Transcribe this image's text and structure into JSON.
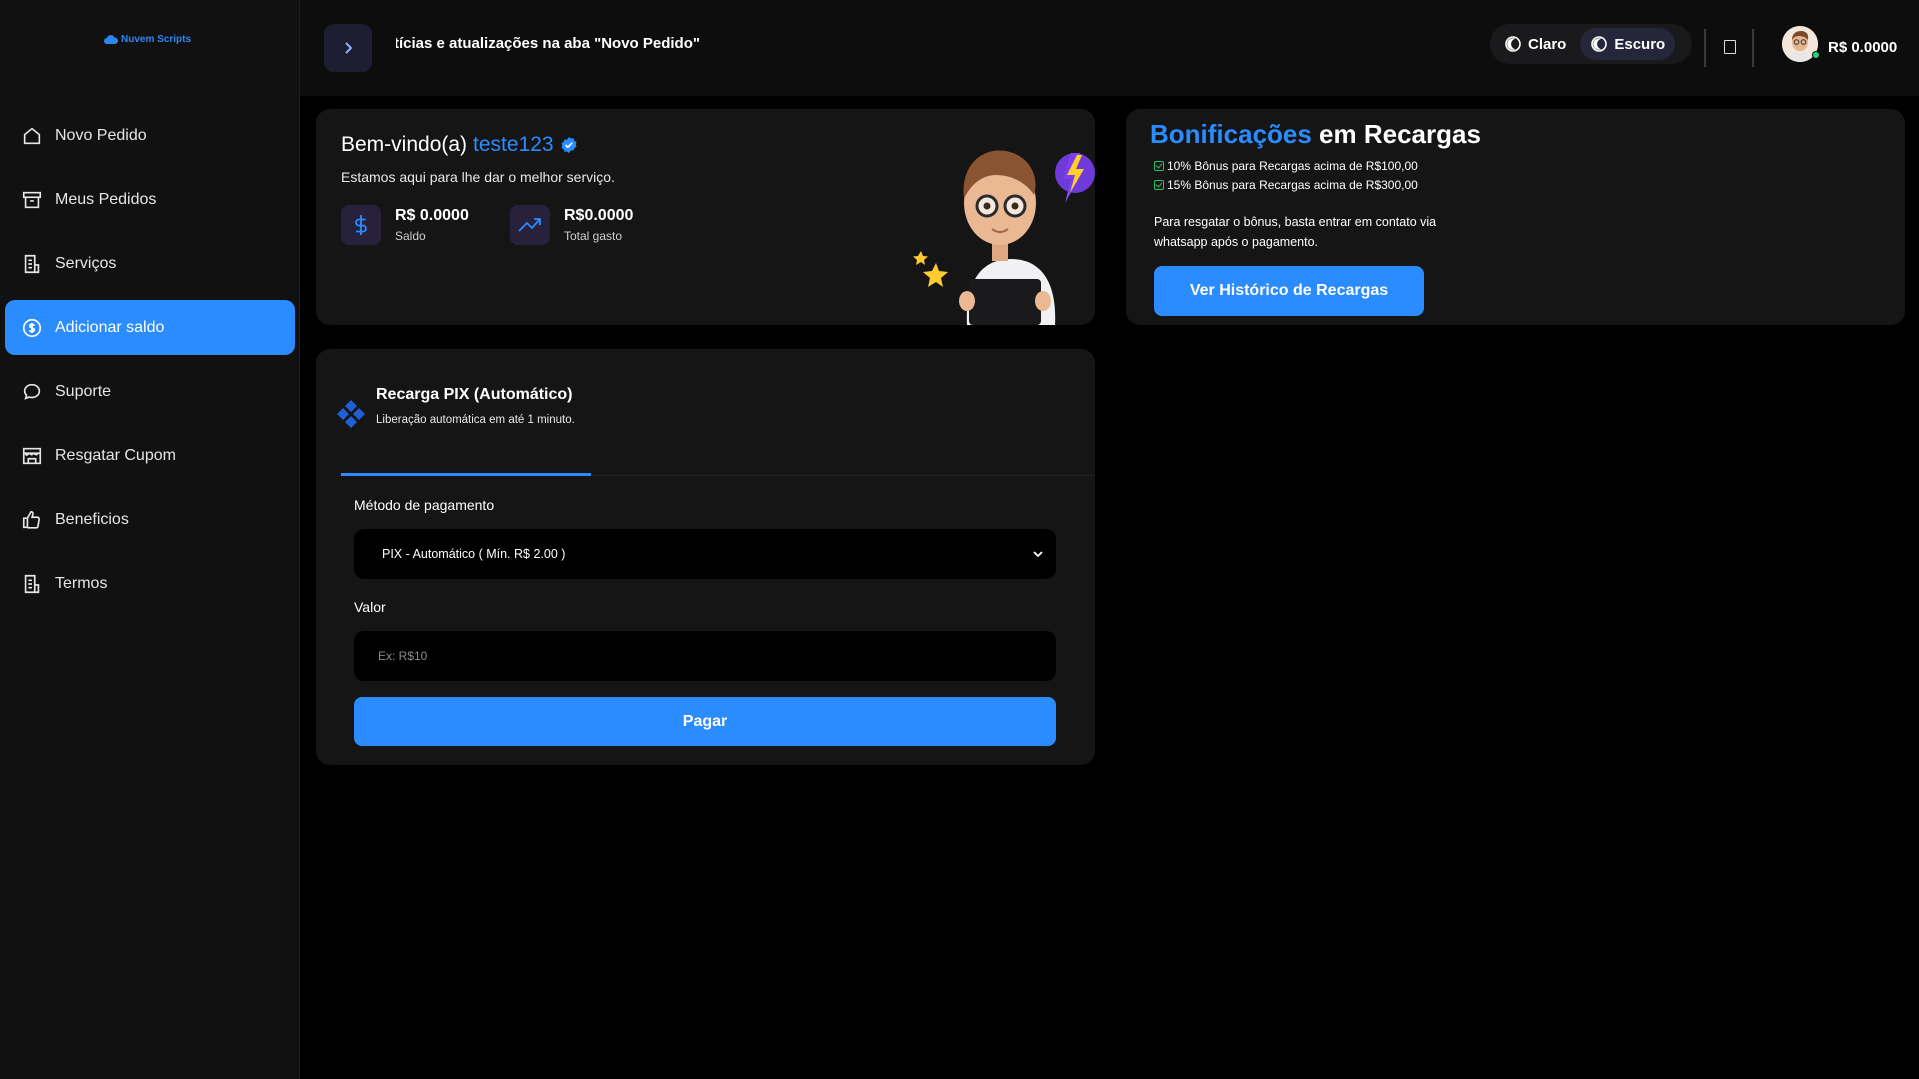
{
  "brand": {
    "logo_text": "Nuvem Scripts",
    "accent": "#2a8cff"
  },
  "sidebar": {
    "items": [
      {
        "label": "Novo Pedido",
        "icon": "home-icon"
      },
      {
        "label": "Meus Pedidos",
        "icon": "archive-icon"
      },
      {
        "label": "Serviços",
        "icon": "list-icon"
      },
      {
        "label": "Adicionar saldo",
        "icon": "dollar-circle-icon",
        "active": true
      },
      {
        "label": "Suporte",
        "icon": "chat-icon"
      },
      {
        "label": "Resgatar Cupom",
        "icon": "store-icon"
      },
      {
        "label": "Beneficios",
        "icon": "thumbs-up-icon"
      },
      {
        "label": "Termos",
        "icon": "document-icon"
      }
    ]
  },
  "topbar": {
    "marquee": "Notícias e atualizações na aba \"Novo Pedido\"",
    "theme_light": "Claro",
    "theme_dark": "Escuro",
    "balance": "R$ 0.0000"
  },
  "welcome": {
    "greeting": "Bem-vindo(a)",
    "username": "teste123",
    "subtitle": "Estamos aqui para lhe dar o melhor serviço.",
    "balance_value": "R$ 0.0000",
    "balance_label": "Saldo",
    "spent_value": "R$0.0000",
    "spent_label": "Total gasto"
  },
  "bonus": {
    "title_highlight": "Bonificações",
    "title_rest": " em Recargas",
    "line1": "10% Bônus para Recargas acima de R$100,00",
    "line2": "15% Bônus para Recargas acima de R$300,00",
    "note": "Para resgatar o bônus, basta entrar em contato via whatsapp após o pagamento.",
    "button": "Ver Histórico de Recargas"
  },
  "pix": {
    "title": "Recarga PIX (Automático)",
    "subtitle": "Liberação automática em até 1 minuto.",
    "method_label": "Método de pagamento",
    "method_value": "PIX - Automático ( Mín. R$ 2.00 )",
    "amount_label": "Valor",
    "amount_placeholder": "Ex: R$10",
    "pay_button": "Pagar"
  }
}
